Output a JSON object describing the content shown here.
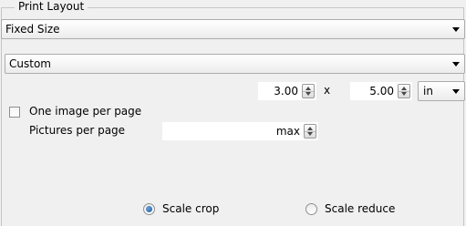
{
  "group": {
    "title": "Print Layout"
  },
  "layout_mode": {
    "value": "Fixed Size"
  },
  "size_preset": {
    "value": "Custom"
  },
  "dimensions": {
    "width": "3.00",
    "separator": "x",
    "height": "5.00",
    "unit": "in"
  },
  "one_image_per_page": {
    "label": "One image per page",
    "checked": false
  },
  "pictures_per_page": {
    "label": "Pictures per page",
    "value": "max"
  },
  "scale_options": {
    "crop_label": "Scale crop",
    "crop_selected": true,
    "reduce_label": "Scale reduce",
    "reduce_selected": false
  }
}
